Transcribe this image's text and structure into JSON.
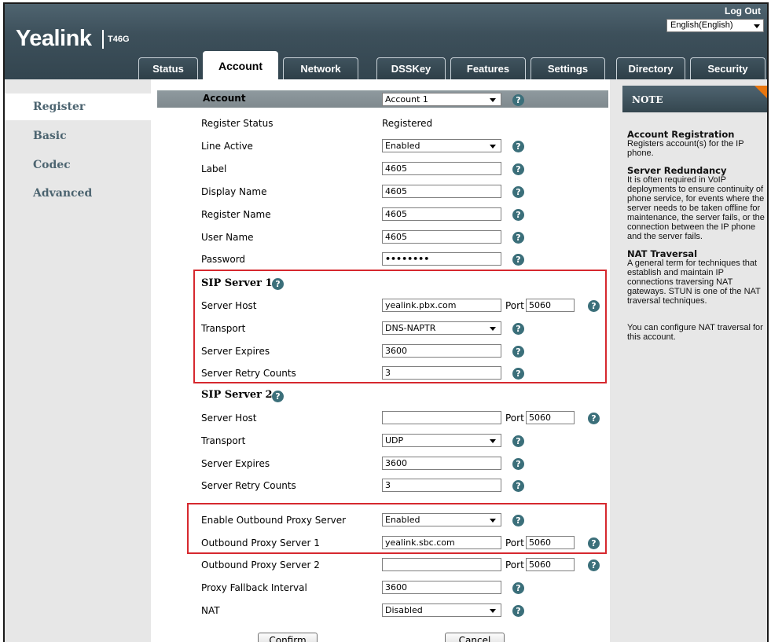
{
  "header": {
    "logo": "Yealink",
    "model": "T46G",
    "logout": "Log Out",
    "language": "English(English)"
  },
  "tabs": [
    {
      "label": "Status",
      "active": false
    },
    {
      "label": "Account",
      "active": true
    },
    {
      "label": "Network",
      "active": false
    },
    {
      "label": "DSSKey",
      "active": false
    },
    {
      "label": "Features",
      "active": false
    },
    {
      "label": "Settings",
      "active": false
    },
    {
      "label": "Directory",
      "active": false
    },
    {
      "label": "Security",
      "active": false
    }
  ],
  "sidebar": {
    "items": [
      {
        "label": "Register",
        "active": true
      },
      {
        "label": "Basic",
        "active": false
      },
      {
        "label": "Codec",
        "active": false
      },
      {
        "label": "Advanced",
        "active": false
      }
    ]
  },
  "form": {
    "account_label": "Account",
    "account_value": "Account 1",
    "register_status_label": "Register Status",
    "register_status_value": "Registered",
    "line_active_label": "Line Active",
    "line_active_value": "Enabled",
    "label_label": "Label",
    "label_value": "4605",
    "display_name_label": "Display Name",
    "display_name_value": "4605",
    "register_name_label": "Register Name",
    "register_name_value": "4605",
    "user_name_label": "User Name",
    "user_name_value": "4605",
    "password_label": "Password",
    "password_value": "••••••••",
    "port_label": "Port",
    "sip1": {
      "title": "SIP Server 1",
      "server_host_label": "Server Host",
      "server_host_value": "yealink.pbx.com",
      "port_value": "5060",
      "transport_label": "Transport",
      "transport_value": "DNS-NAPTR",
      "expires_label": "Server Expires",
      "expires_value": "3600",
      "retry_label": "Server Retry Counts",
      "retry_value": "3"
    },
    "sip2": {
      "title": "SIP Server 2",
      "server_host_label": "Server Host",
      "server_host_value": "",
      "port_value": "5060",
      "transport_label": "Transport",
      "transport_value": "UDP",
      "expires_label": "Server Expires",
      "expires_value": "3600",
      "retry_label": "Server Retry Counts",
      "retry_value": "3"
    },
    "outbound_enable_label": "Enable Outbound Proxy Server",
    "outbound_enable_value": "Enabled",
    "outbound1_label": "Outbound Proxy Server 1",
    "outbound1_value": "yealink.sbc.com",
    "outbound1_port": "5060",
    "outbound2_label": "Outbound Proxy Server 2",
    "outbound2_value": "",
    "outbound2_port": "5060",
    "fallback_label": "Proxy Fallback Interval",
    "fallback_value": "3600",
    "nat_label": "NAT",
    "nat_value": "Disabled",
    "help_glyph": "?",
    "confirm": "Confirm",
    "cancel": "Cancel"
  },
  "note": {
    "title": "NOTE",
    "sections": [
      {
        "heading": "Account Registration",
        "text": "Registers account(s) for the IP phone."
      },
      {
        "heading": "Server Redundancy",
        "text": "It is often required in VoIP deployments to ensure continuity of phone service, for events where the server needs to be taken offline for maintenance, the server fails, or the connection between the IP phone and the server fails."
      },
      {
        "heading": "NAT Traversal",
        "text": "A general term for techniques that establish and maintain IP connections traversing NAT gateways. STUN is one of the NAT traversal techniques."
      },
      {
        "heading": "",
        "text": "You can configure NAT traversal for this account."
      }
    ]
  },
  "colors": {
    "header": "#3d505b",
    "nav_text": "#4c6470",
    "highlight_box": "#d6282e",
    "help_icon": "#3b6f7a",
    "note_corner": "#e8760f"
  }
}
